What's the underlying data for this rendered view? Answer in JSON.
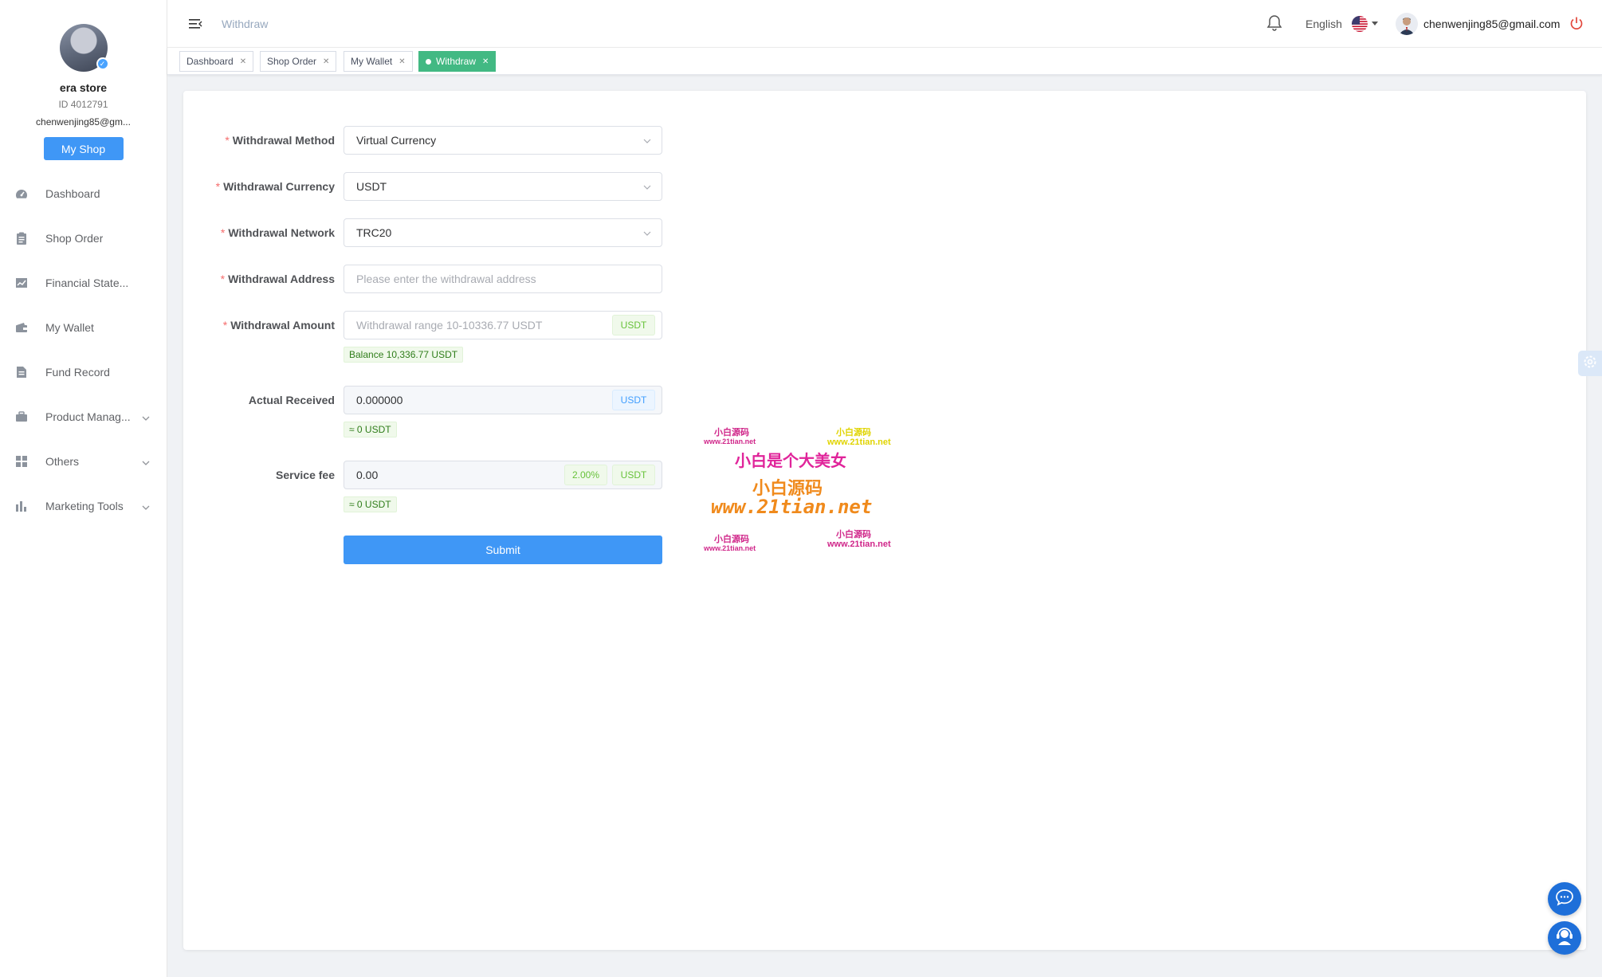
{
  "sidebar": {
    "profile": {
      "shop_name": "era store",
      "shop_id": "ID 4012791",
      "email": "chenwenjing85@gm..."
    },
    "my_shop_label": "My Shop",
    "items": [
      {
        "label": "Dashboard",
        "icon": "dashboard-icon"
      },
      {
        "label": "Shop Order",
        "icon": "clipboard-icon"
      },
      {
        "label": "Financial State...",
        "icon": "line-chart-icon"
      },
      {
        "label": "My Wallet",
        "icon": "wallet-icon"
      },
      {
        "label": "Fund Record",
        "icon": "document-icon"
      },
      {
        "label": "Product Manag...",
        "icon": "briefcase-icon",
        "expandable": true
      },
      {
        "label": "Others",
        "icon": "grid-icon",
        "expandable": true
      },
      {
        "label": "Marketing Tools",
        "icon": "bar-chart-icon",
        "expandable": true
      }
    ]
  },
  "header": {
    "breadcrumb": "Withdraw",
    "language": "English",
    "user_email": "chenwenjing85@gmail.com"
  },
  "tags": [
    {
      "label": "Dashboard",
      "active": false
    },
    {
      "label": "Shop Order",
      "active": false
    },
    {
      "label": "My Wallet",
      "active": false
    },
    {
      "label": "Withdraw",
      "active": true
    }
  ],
  "form": {
    "method": {
      "label": "Withdrawal Method",
      "value": "Virtual Currency"
    },
    "currency": {
      "label": "Withdrawal Currency",
      "value": "USDT"
    },
    "network": {
      "label": "Withdrawal Network",
      "value": "TRC20"
    },
    "address": {
      "label": "Withdrawal Address",
      "placeholder": "Please enter the withdrawal address"
    },
    "amount": {
      "label": "Withdrawal Amount",
      "placeholder": "Withdrawal range 10-10336.77 USDT",
      "unit": "USDT",
      "balance": "Balance 10,336.77 USDT"
    },
    "received": {
      "label": "Actual Received",
      "value": "0.000000",
      "unit": "USDT",
      "approx": "≈ 0 USDT"
    },
    "fee": {
      "label": "Service fee",
      "value": "0.00",
      "rate": "2.00%",
      "unit": "USDT",
      "approx": "≈ 0 USDT"
    },
    "submit_label": "Submit"
  },
  "watermark": {
    "small_cn": "小白源码",
    "small_url": "www.21tian.net",
    "headline": "小白是个大美女",
    "brand_cn": "小白源码",
    "brand_url": "www.21tian.net"
  },
  "colors": {
    "primary": "#3f97f6",
    "active_tag": "#42b983",
    "required": "#f56c6c",
    "hint_green": "#67c23a"
  }
}
